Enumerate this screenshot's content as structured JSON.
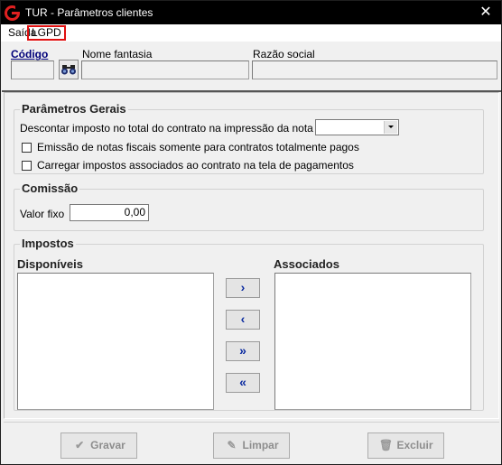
{
  "window": {
    "title": "TUR - Parâmetros clientes",
    "close_glyph": "✕",
    "app_icon": "g-logo-icon"
  },
  "menu": {
    "items": [
      "Saída",
      "LGPD"
    ]
  },
  "header": {
    "codigo_label": "Código",
    "codigo_value": "",
    "nome_fantasia_label": "Nome fantasia",
    "nome_fantasia_value": "",
    "razao_social_label": "Razão social",
    "razao_social_value": "",
    "search_icon": "binoculars-icon"
  },
  "parametros_gerais": {
    "title": "Parâmetros Gerais",
    "descontar_label": "Descontar imposto no total do contrato na impressão da nota fiscal",
    "descontar_value": "",
    "emissao_label": "Emissão de notas fiscais somente para contratos totalmente pagos",
    "emissao_checked": false,
    "carregar_label": "Carregar impostos associados ao contrato na tela de pagamentos",
    "carregar_checked": false
  },
  "comissao": {
    "title": "Comissão",
    "valor_fixo_label": "Valor fixo",
    "valor_fixo_value": "0,00"
  },
  "impostos": {
    "title": "Impostos",
    "disponiveis_label": "Disponíveis",
    "associados_label": "Associados",
    "disponiveis_items": [],
    "associados_items": [],
    "buttons": [
      "›",
      "‹",
      "»",
      "«"
    ]
  },
  "footer": {
    "gravar_label": "Gravar",
    "limpar_label": "Limpar",
    "excluir_label": "Excluir",
    "colors": {
      "disabled_text": "#8d8d8d"
    }
  },
  "colors": {
    "titlebar": "#000000",
    "highlight_border": "#e01010",
    "codigo_label": "#00007a",
    "arrow": "#0a2aa0"
  }
}
